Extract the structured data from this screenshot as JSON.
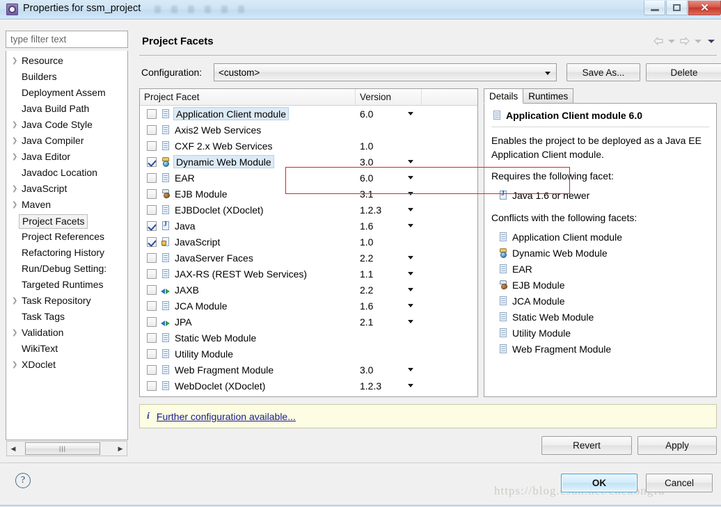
{
  "window": {
    "title": "Properties for ssm_project",
    "icon": "eclipse-properties-icon",
    "minimize_label": "",
    "maximize_label": "",
    "close_label": "✕"
  },
  "sidebar": {
    "filter_placeholder": "type filter text",
    "items": [
      {
        "label": "Resource",
        "expandable": true,
        "selected": false
      },
      {
        "label": "Builders",
        "expandable": false,
        "selected": false
      },
      {
        "label": "Deployment Assem",
        "expandable": false,
        "selected": false
      },
      {
        "label": "Java Build Path",
        "expandable": false,
        "selected": false
      },
      {
        "label": "Java Code Style",
        "expandable": true,
        "selected": false
      },
      {
        "label": "Java Compiler",
        "expandable": true,
        "selected": false
      },
      {
        "label": "Java Editor",
        "expandable": true,
        "selected": false
      },
      {
        "label": "Javadoc Location",
        "expandable": false,
        "selected": false
      },
      {
        "label": "JavaScript",
        "expandable": true,
        "selected": false
      },
      {
        "label": "Maven",
        "expandable": true,
        "selected": false
      },
      {
        "label": "Project Facets",
        "expandable": false,
        "selected": true
      },
      {
        "label": "Project References",
        "expandable": false,
        "selected": false
      },
      {
        "label": "Refactoring History",
        "expandable": false,
        "selected": false
      },
      {
        "label": "Run/Debug Setting:",
        "expandable": false,
        "selected": false
      },
      {
        "label": "Targeted Runtimes",
        "expandable": false,
        "selected": false
      },
      {
        "label": "Task Repository",
        "expandable": true,
        "selected": false
      },
      {
        "label": "Task Tags",
        "expandable": false,
        "selected": false
      },
      {
        "label": "Validation",
        "expandable": true,
        "selected": false
      },
      {
        "label": "WikiText",
        "expandable": false,
        "selected": false
      },
      {
        "label": "XDoclet",
        "expandable": true,
        "selected": false
      }
    ],
    "scrollbar_thumb_glyph": "|||"
  },
  "page": {
    "title": "Project Facets",
    "nav": {
      "back_icon": "arrow-left-icon",
      "forward_icon": "arrow-right-icon",
      "menu_icon": "chevron-down-icon"
    }
  },
  "configuration": {
    "label": "Configuration:",
    "value": "<custom>",
    "save_as_label": "Save As...",
    "delete_label": "Delete"
  },
  "facet_table": {
    "columns": [
      "Project Facet",
      "Version",
      ""
    ],
    "rows": [
      {
        "name": "Application Client module",
        "version": "6.0",
        "checked": false,
        "highlighted": true,
        "icon": "doc",
        "expandable": false,
        "has_version_menu": true
      },
      {
        "name": "Axis2 Web Services",
        "version": "",
        "checked": false,
        "highlighted": false,
        "icon": "doc",
        "expandable": true,
        "has_version_menu": false
      },
      {
        "name": "CXF 2.x Web Services",
        "version": "1.0",
        "checked": false,
        "highlighted": false,
        "icon": "doc",
        "expandable": false,
        "has_version_menu": false
      },
      {
        "name": "Dynamic Web Module",
        "version": "3.0",
        "checked": true,
        "highlighted": true,
        "icon": "web",
        "expandable": false,
        "has_version_menu": true
      },
      {
        "name": "EAR",
        "version": "6.0",
        "checked": false,
        "highlighted": false,
        "icon": "doc",
        "expandable": false,
        "has_version_menu": true
      },
      {
        "name": "EJB Module",
        "version": "3.1",
        "checked": false,
        "highlighted": false,
        "icon": "ejb",
        "expandable": false,
        "has_version_menu": true
      },
      {
        "name": "EJBDoclet (XDoclet)",
        "version": "1.2.3",
        "checked": false,
        "highlighted": false,
        "icon": "doc",
        "expandable": false,
        "has_version_menu": true
      },
      {
        "name": "Java",
        "version": "1.6",
        "checked": true,
        "highlighted": false,
        "icon": "java",
        "expandable": false,
        "has_version_menu": true
      },
      {
        "name": "JavaScript",
        "version": "1.0",
        "checked": true,
        "highlighted": false,
        "icon": "js",
        "expandable": false,
        "has_version_menu": false
      },
      {
        "name": "JavaServer Faces",
        "version": "2.2",
        "checked": false,
        "highlighted": false,
        "icon": "doc",
        "expandable": false,
        "has_version_menu": true
      },
      {
        "name": "JAX-RS (REST Web Services)",
        "version": "1.1",
        "checked": false,
        "highlighted": false,
        "icon": "doc",
        "expandable": false,
        "has_version_menu": true
      },
      {
        "name": "JAXB",
        "version": "2.2",
        "checked": false,
        "highlighted": false,
        "icon": "arrows",
        "expandable": false,
        "has_version_menu": true
      },
      {
        "name": "JCA Module",
        "version": "1.6",
        "checked": false,
        "highlighted": false,
        "icon": "doc",
        "expandable": false,
        "has_version_menu": true
      },
      {
        "name": "JPA",
        "version": "2.1",
        "checked": false,
        "highlighted": false,
        "icon": "arrows",
        "expandable": false,
        "has_version_menu": true
      },
      {
        "name": "Static Web Module",
        "version": "",
        "checked": false,
        "highlighted": false,
        "icon": "doc",
        "expandable": false,
        "has_version_menu": false
      },
      {
        "name": "Utility Module",
        "version": "",
        "checked": false,
        "highlighted": false,
        "icon": "doc",
        "expandable": false,
        "has_version_menu": false
      },
      {
        "name": "Web Fragment Module",
        "version": "3.0",
        "checked": false,
        "highlighted": false,
        "icon": "doc",
        "expandable": false,
        "has_version_menu": true
      },
      {
        "name": "WebDoclet (XDoclet)",
        "version": "1.2.3",
        "checked": false,
        "highlighted": false,
        "icon": "doc",
        "expandable": false,
        "has_version_menu": true
      }
    ],
    "annotation_color": "#e02020"
  },
  "details": {
    "tabs": [
      {
        "label": "Details",
        "active": true
      },
      {
        "label": "Runtimes",
        "active": false
      }
    ],
    "heading": "Application Client module 6.0",
    "heading_icon": "doc",
    "description": "Enables the project to be deployed as a Java EE Application Client module.",
    "requires_label": "Requires the following facet:",
    "requires": [
      {
        "label": "Java 1.6 or newer",
        "icon": "java"
      }
    ],
    "conflicts_label": "Conflicts with the following facets:",
    "conflicts": [
      {
        "label": "Application Client module",
        "icon": "doc"
      },
      {
        "label": "Dynamic Web Module",
        "icon": "web"
      },
      {
        "label": "EAR",
        "icon": "doc"
      },
      {
        "label": "EJB Module",
        "icon": "ejb"
      },
      {
        "label": "JCA Module",
        "icon": "doc"
      },
      {
        "label": "Static Web Module",
        "icon": "doc"
      },
      {
        "label": "Utility Module",
        "icon": "doc"
      },
      {
        "label": "Web Fragment Module",
        "icon": "doc"
      }
    ]
  },
  "info_bar": {
    "icon": "info-icon",
    "icon_glyph": "i",
    "link_text": "Further configuration available..."
  },
  "actions": {
    "revert_label": "Revert",
    "apply_label": "Apply",
    "ok_label": "OK",
    "cancel_label": "Cancel",
    "help_glyph": "?"
  },
  "watermark": {
    "text": "https://blog.csdn.net/chekongfu"
  }
}
